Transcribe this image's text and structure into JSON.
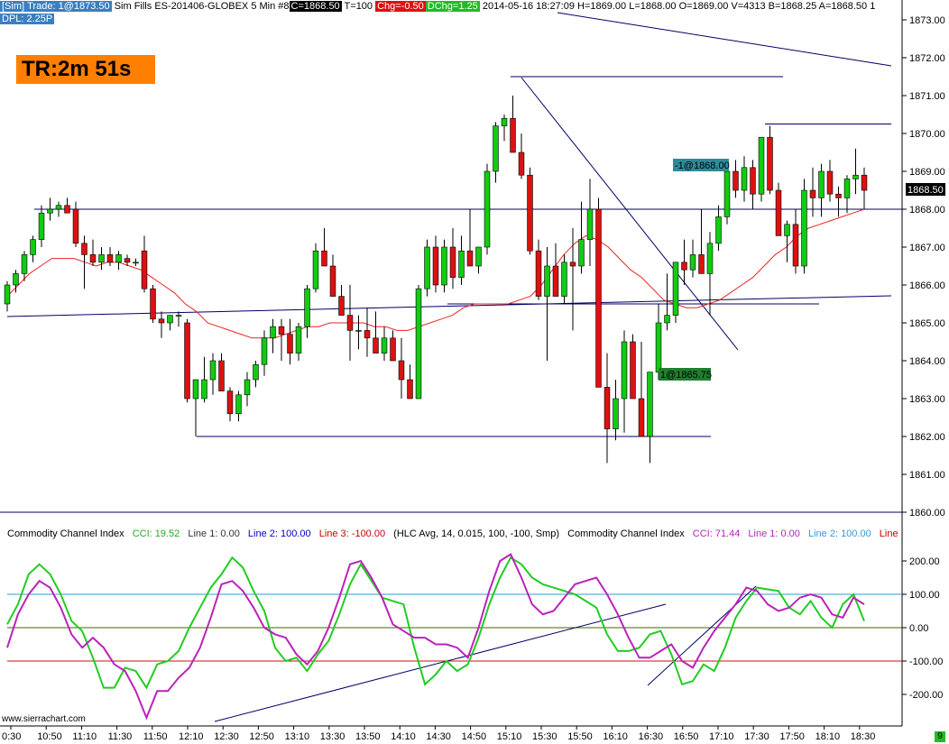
{
  "header": {
    "sim_label": "[Sim]",
    "trade_label": "Trade: 1@1873.50",
    "sim_fills": "Sim Fills",
    "symbol": "ES-201406-GLOBEX",
    "interval": "5 Min",
    "chart_number": "#8",
    "close": "C=1868.50",
    "ticks": "T=100",
    "change": "Chg=-0.50",
    "daily_change": "DChg=1.25",
    "stats": "2014-05-16 18:27:09 H=1869.00 L=1868.00 O=1869.00 V=4313 B=1868.25 A=1868.50 1",
    "dpl": "DPL: 2.25P"
  },
  "timer": {
    "label": "TR:2m 51s"
  },
  "trade_markers": {
    "sell": "-1@1868.00",
    "buy": "1@1865.75"
  },
  "last_price": "1868.50",
  "indicator_header": {
    "name": "Commodity Channel Index",
    "cci": "CCI: 19.52",
    "line1": "Line 1: 0.00",
    "line2": "Line 2: 100.00",
    "line3": "Line 3: -100.00",
    "params": "(HLC Avg, 14, 0.015, 100, -100, Smp)",
    "name2": "Commodity Channel Index",
    "cci2": "CCI: 71.44",
    "line1b": "Line 1: 0.00",
    "line2b": "Line 2: 100.00",
    "line3b": "Line"
  },
  "website": "www.sierrachart.com",
  "corner_badge": "9",
  "colors": {
    "up": "#11cc11",
    "down": "#dd1111",
    "ma": "#ee2222",
    "cci1": "#22cc22",
    "cci2": "#bb22bb",
    "trend": "#000066",
    "line100": "#3399dd",
    "line_neg100": "#cc1111",
    "line0": "#446600"
  },
  "chart_data": {
    "type": "candlestick",
    "price_axis": {
      "min": 1860,
      "max": 1873,
      "ticks": [
        "1873.00",
        "1872.00",
        "1871.00",
        "1870.00",
        "1869.00",
        "1868.00",
        "1867.00",
        "1866.00",
        "1865.00",
        "1864.00",
        "1863.00",
        "1862.00",
        "1861.00",
        "1860.00"
      ]
    },
    "cci_axis": {
      "min": -250,
      "max": 250,
      "ticks": [
        "200.00",
        "100.00",
        "0.00",
        "-100.00",
        "-200.00"
      ]
    },
    "time_labels": [
      "0:30",
      "10:50",
      "11:10",
      "11:30",
      "11:50",
      "12:10",
      "12:30",
      "12:50",
      "13:10",
      "13:30",
      "13:50",
      "14:10",
      "14:30",
      "14:50",
      "15:10",
      "15:30",
      "15:50",
      "16:10",
      "16:30",
      "16:50",
      "17:10",
      "17:30",
      "17:50",
      "18:10",
      "18:30"
    ],
    "candles": [
      [
        1865.5,
        1866.1,
        1865.3,
        1866.0
      ],
      [
        1866.0,
        1866.4,
        1865.8,
        1866.3
      ],
      [
        1866.3,
        1866.9,
        1866.1,
        1866.8
      ],
      [
        1866.8,
        1867.3,
        1866.6,
        1867.2
      ],
      [
        1867.2,
        1868.1,
        1867.0,
        1867.9
      ],
      [
        1867.9,
        1868.3,
        1867.7,
        1868.0
      ],
      [
        1868.0,
        1868.2,
        1867.8,
        1868.1
      ],
      [
        1868.1,
        1868.3,
        1867.9,
        1867.9
      ],
      [
        1868.0,
        1868.2,
        1867.0,
        1867.1
      ],
      [
        1867.1,
        1867.3,
        1865.9,
        1866.8
      ],
      [
        1866.8,
        1867.2,
        1866.5,
        1866.6
      ],
      [
        1866.6,
        1867.0,
        1866.4,
        1866.8
      ],
      [
        1866.8,
        1867.0,
        1866.5,
        1866.6
      ],
      [
        1866.6,
        1866.9,
        1866.4,
        1866.8
      ],
      [
        1866.7,
        1866.8,
        1866.5,
        1866.6
      ],
      [
        1866.6,
        1866.7,
        1866.5,
        1866.6
      ],
      [
        1866.9,
        1867.3,
        1865.8,
        1865.9
      ],
      [
        1865.9,
        1866.0,
        1865.0,
        1865.1
      ],
      [
        1865.1,
        1865.3,
        1864.6,
        1865.0
      ],
      [
        1865.0,
        1865.2,
        1864.8,
        1865.2
      ],
      [
        1865.2,
        1865.3,
        1864.9,
        1865.2
      ],
      [
        1865.0,
        1865.1,
        1862.9,
        1863.0
      ],
      [
        1863.0,
        1863.2,
        1862.0,
        1863.5
      ],
      [
        1863.0,
        1864.1,
        1862.9,
        1863.5
      ],
      [
        1863.5,
        1864.2,
        1863.1,
        1864.0
      ],
      [
        1864.0,
        1864.2,
        1863.5,
        1863.2
      ],
      [
        1863.2,
        1863.3,
        1862.4,
        1862.6
      ],
      [
        1862.6,
        1863.2,
        1862.4,
        1863.1
      ],
      [
        1863.1,
        1863.7,
        1862.8,
        1863.5
      ],
      [
        1863.5,
        1864.0,
        1863.3,
        1863.9
      ],
      [
        1863.9,
        1864.8,
        1863.6,
        1864.6
      ],
      [
        1864.6,
        1865.1,
        1864.2,
        1864.9
      ],
      [
        1864.9,
        1865.1,
        1864.0,
        1864.7
      ],
      [
        1864.7,
        1865.1,
        1863.9,
        1864.2
      ],
      [
        1864.2,
        1865.0,
        1864.0,
        1864.9
      ],
      [
        1864.9,
        1866.0,
        1864.6,
        1865.9
      ],
      [
        1865.9,
        1867.1,
        1865.8,
        1866.9
      ],
      [
        1866.9,
        1867.5,
        1866.5,
        1866.5
      ],
      [
        1866.5,
        1866.8,
        1866.0,
        1865.7
      ],
      [
        1865.7,
        1866.0,
        1865.2,
        1865.2
      ],
      [
        1865.2,
        1866.0,
        1864.0,
        1864.8
      ],
      [
        1864.8,
        1865.2,
        1864.3,
        1864.8
      ],
      [
        1864.8,
        1865.4,
        1864.1,
        1864.6
      ],
      [
        1864.6,
        1865.3,
        1864.3,
        1864.2
      ],
      [
        1864.2,
        1864.9,
        1864.0,
        1864.6
      ],
      [
        1864.6,
        1864.8,
        1864.0,
        1864.0
      ],
      [
        1864.0,
        1864.6,
        1863.0,
        1863.5
      ],
      [
        1863.5,
        1863.9,
        1863.0,
        1863.0
      ],
      [
        1863.0,
        1866.0,
        1863.0,
        1865.9
      ],
      [
        1865.9,
        1867.2,
        1865.7,
        1867.0
      ],
      [
        1867.0,
        1867.3,
        1865.8,
        1866.0
      ],
      [
        1866.0,
        1867.2,
        1865.8,
        1867.0
      ],
      [
        1867.0,
        1867.5,
        1865.9,
        1866.2
      ],
      [
        1866.2,
        1867.3,
        1866.0,
        1866.9
      ],
      [
        1866.9,
        1868.0,
        1866.6,
        1866.5
      ],
      [
        1866.5,
        1867.0,
        1866.3,
        1867.0
      ],
      [
        1867.0,
        1869.2,
        1866.8,
        1869.0
      ],
      [
        1869.0,
        1870.3,
        1868.7,
        1870.2
      ],
      [
        1870.2,
        1870.5,
        1869.8,
        1870.4
      ],
      [
        1870.4,
        1871.0,
        1869.5,
        1869.5
      ],
      [
        1869.5,
        1870.0,
        1868.8,
        1868.9
      ],
      [
        1868.9,
        1869.1,
        1866.8,
        1866.9
      ],
      [
        1866.9,
        1867.2,
        1865.6,
        1865.7
      ],
      [
        1865.7,
        1867.0,
        1864.0,
        1866.5
      ],
      [
        1866.5,
        1867.1,
        1865.8,
        1865.7
      ],
      [
        1865.7,
        1866.8,
        1865.5,
        1866.6
      ],
      [
        1866.6,
        1867.5,
        1864.8,
        1866.5
      ],
      [
        1866.5,
        1868.2,
        1866.3,
        1867.2
      ],
      [
        1867.2,
        1868.8,
        1866.5,
        1868.0
      ],
      [
        1868.0,
        1868.3,
        1864.9,
        1863.3
      ],
      [
        1863.3,
        1864.2,
        1861.3,
        1862.2
      ],
      [
        1862.2,
        1863.5,
        1861.9,
        1863.0
      ],
      [
        1863.0,
        1864.8,
        1862.1,
        1864.5
      ],
      [
        1864.5,
        1864.7,
        1863.1,
        1863.0
      ],
      [
        1863.0,
        1864.5,
        1862.0,
        1862.0
      ],
      [
        1862.0,
        1863.5,
        1861.3,
        1863.7
      ],
      [
        1863.7,
        1865.5,
        1863.5,
        1865.0
      ],
      [
        1865.0,
        1866.3,
        1864.8,
        1865.2
      ],
      [
        1865.2,
        1866.3,
        1865.0,
        1866.6
      ],
      [
        1866.6,
        1867.2,
        1866.0,
        1866.4
      ],
      [
        1866.4,
        1867.2,
        1866.2,
        1866.8
      ],
      [
        1866.8,
        1868.0,
        1866.5,
        1866.3
      ],
      [
        1866.3,
        1867.4,
        1865.2,
        1867.1
      ],
      [
        1867.1,
        1868.1,
        1866.9,
        1867.8
      ],
      [
        1867.8,
        1869.2,
        1867.6,
        1869.0
      ],
      [
        1869.0,
        1869.3,
        1868.3,
        1868.5
      ],
      [
        1868.5,
        1869.4,
        1868.2,
        1869.1
      ],
      [
        1869.1,
        1869.3,
        1868.0,
        1868.4
      ],
      [
        1868.4,
        1869.9,
        1868.2,
        1869.9
      ],
      [
        1869.9,
        1870.2,
        1868.4,
        1868.5
      ],
      [
        1868.5,
        1868.7,
        1867.3,
        1867.3
      ],
      [
        1867.3,
        1867.7,
        1866.6,
        1867.6
      ],
      [
        1867.6,
        1868.0,
        1866.3,
        1866.5
      ],
      [
        1866.5,
        1868.8,
        1866.3,
        1868.5
      ],
      [
        1868.5,
        1869.1,
        1867.8,
        1868.3
      ],
      [
        1868.3,
        1869.2,
        1867.8,
        1869.0
      ],
      [
        1869.0,
        1869.3,
        1868.2,
        1868.4
      ],
      [
        1868.4,
        1868.6,
        1867.8,
        1868.3
      ],
      [
        1868.3,
        1868.9,
        1867.9,
        1868.8
      ],
      [
        1868.8,
        1869.6,
        1868.4,
        1868.9
      ],
      [
        1868.9,
        1869.1,
        1868.0,
        1868.5
      ]
    ],
    "moving_average": [
      1865.7,
      1866.0,
      1866.3,
      1866.5,
      1866.7,
      1866.7,
      1866.7,
      1866.6,
      1866.5,
      1866.6,
      1866.6,
      1866.5,
      1866.4,
      1866.2,
      1866.0,
      1865.8,
      1865.5,
      1865.3,
      1865.0,
      1864.9,
      1864.8,
      1864.7,
      1864.6,
      1864.6,
      1864.6,
      1864.7,
      1864.8,
      1864.9,
      1864.9,
      1865.0,
      1865.0,
      1865.0,
      1865.0,
      1864.9,
      1864.9,
      1864.8,
      1864.8,
      1864.9,
      1865.0,
      1865.1,
      1865.2,
      1865.4,
      1865.5,
      1865.5,
      1865.5,
      1865.5,
      1865.6,
      1865.7,
      1866.0,
      1866.4,
      1866.8,
      1867.1,
      1867.3,
      1867.2,
      1867.0,
      1866.7,
      1866.4,
      1866.2,
      1865.9,
      1865.6,
      1865.5,
      1865.4,
      1865.4,
      1865.5,
      1865.6,
      1865.8,
      1866.0,
      1866.2,
      1866.5,
      1866.8,
      1867.0,
      1867.3,
      1867.5,
      1867.6,
      1867.7,
      1867.8,
      1867.9,
      1868.0
    ],
    "cci_series": [
      {
        "name": "CCI",
        "value": 19.52,
        "values": [
          10,
          70,
          160,
          190,
          160,
          100,
          20,
          -10,
          -90,
          -180,
          -180,
          -120,
          -130,
          -180,
          -110,
          -100,
          -70,
          0,
          60,
          120,
          160,
          210,
          180,
          110,
          50,
          -60,
          -100,
          -90,
          -130,
          -80,
          -40,
          40,
          130,
          190,
          140,
          90,
          80,
          70,
          -60,
          -170,
          -140,
          -100,
          -130,
          -110,
          -30,
          70,
          150,
          210,
          190,
          150,
          130,
          120,
          110,
          100,
          80,
          60,
          -20,
          -70,
          -70,
          -60,
          -20,
          -10,
          -80,
          -170,
          -160,
          -110,
          -130,
          -60,
          30,
          80,
          120,
          115,
          110,
          60,
          40,
          80,
          30,
          0,
          70,
          100,
          20
        ]
      },
      {
        "name": "CCI",
        "value": 71.44,
        "values": [
          -60,
          40,
          100,
          140,
          120,
          60,
          -20,
          -60,
          -30,
          -60,
          -110,
          -130,
          -190,
          -270,
          -190,
          -190,
          -150,
          -120,
          -60,
          30,
          130,
          140,
          110,
          60,
          0,
          -20,
          -30,
          -80,
          -110,
          -70,
          0,
          90,
          190,
          200,
          150,
          90,
          10,
          -10,
          -30,
          -30,
          -50,
          -50,
          -60,
          -90,
          0,
          110,
          200,
          220,
          150,
          70,
          40,
          50,
          90,
          130,
          140,
          150,
          100,
          40,
          -30,
          -90,
          -90,
          -70,
          -50,
          -100,
          -120,
          -60,
          -10,
          30,
          70,
          120,
          110,
          70,
          50,
          60,
          90,
          100,
          90,
          40,
          30,
          90,
          70
        ]
      }
    ],
    "trend_lines": "drawn",
    "grid": false
  }
}
